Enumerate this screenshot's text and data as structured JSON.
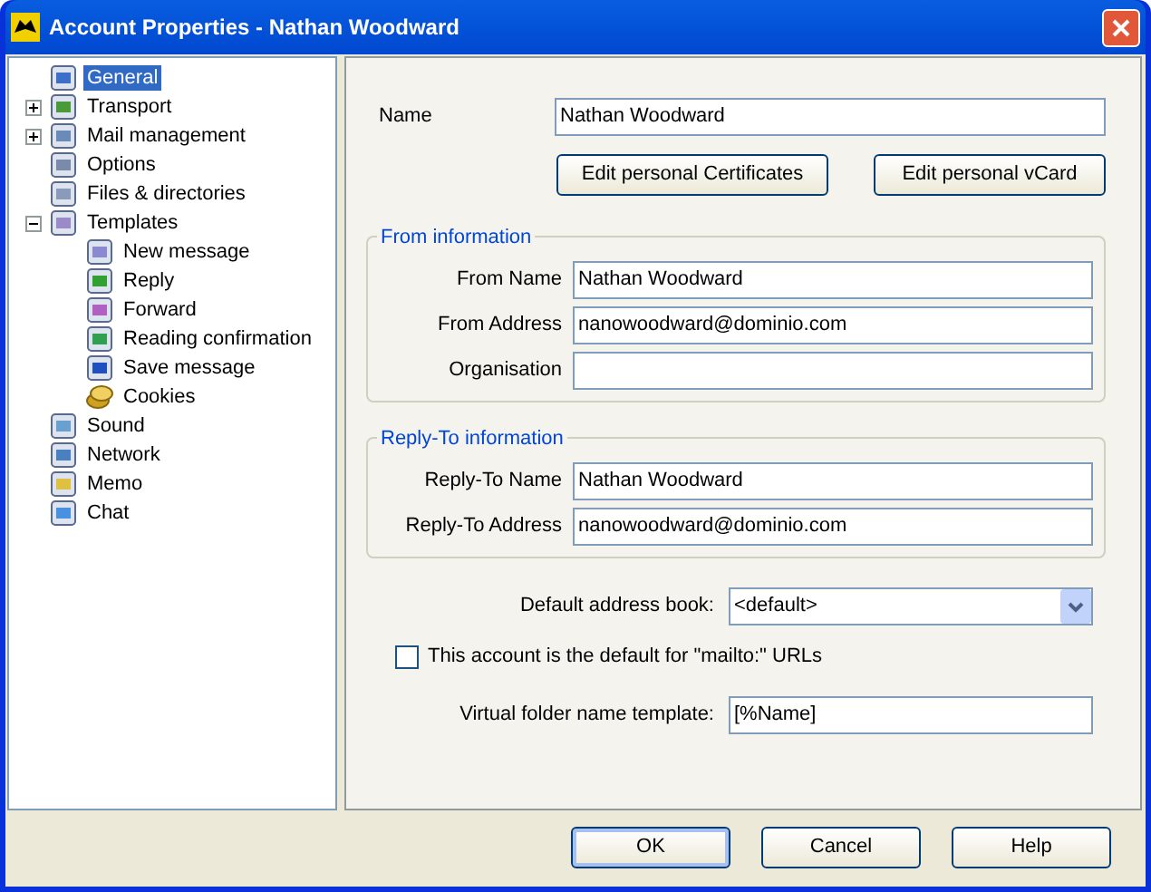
{
  "window": {
    "title": "Account Properties - Nathan Woodward"
  },
  "tree": [
    {
      "label": "General",
      "selected": true
    },
    {
      "label": "Transport",
      "selected": false,
      "expanded": false
    },
    {
      "label": "Mail management",
      "selected": false,
      "expanded": false
    },
    {
      "label": "Options",
      "selected": false
    },
    {
      "label": "Files & directories",
      "selected": false
    },
    {
      "label": "Templates",
      "selected": false,
      "expanded": true,
      "children": [
        {
          "label": "New message",
          "selected": false
        },
        {
          "label": "Reply",
          "selected": false
        },
        {
          "label": "Forward",
          "selected": false
        },
        {
          "label": "Reading confirmation",
          "selected": false
        },
        {
          "label": "Save message",
          "selected": false
        },
        {
          "label": "Cookies",
          "selected": false
        }
      ]
    },
    {
      "label": "Sound",
      "selected": false
    },
    {
      "label": "Network",
      "selected": false
    },
    {
      "label": "Memo",
      "selected": false
    },
    {
      "label": "Chat",
      "selected": false
    }
  ],
  "name": {
    "label": "Name",
    "value": "Nathan Woodward"
  },
  "buttons": [
    "Edit personal Certificates",
    "Edit personal vCard"
  ],
  "groups": [
    {
      "title": "From information",
      "fields": [
        {
          "label": "From Name",
          "value": "Nathan Woodward"
        },
        {
          "label": "From Address",
          "value": "nanowoodward@dominio.com"
        },
        {
          "label": "Organisation"
        }
      ]
    },
    {
      "title": "Reply-To information",
      "fields": [
        {
          "label": "Reply-To Name",
          "value": "Nathan Woodward"
        },
        {
          "label": "Reply-To Address",
          "value": "nanowoodward@dominio.com"
        }
      ]
    }
  ],
  "address_book": {
    "label": "Default address book:",
    "value": "<default>"
  },
  "mailto_default": {
    "label": "This account is the default for \"mailto:\" URLs",
    "checked": false
  },
  "virtual_folder": {
    "label": "Virtual folder name template:",
    "value": "[%Name]"
  },
  "footer_buttons": [
    {
      "label": "OK",
      "default": true
    },
    {
      "label": "Cancel",
      "default": false
    },
    {
      "label": "Help",
      "default": false
    }
  ]
}
